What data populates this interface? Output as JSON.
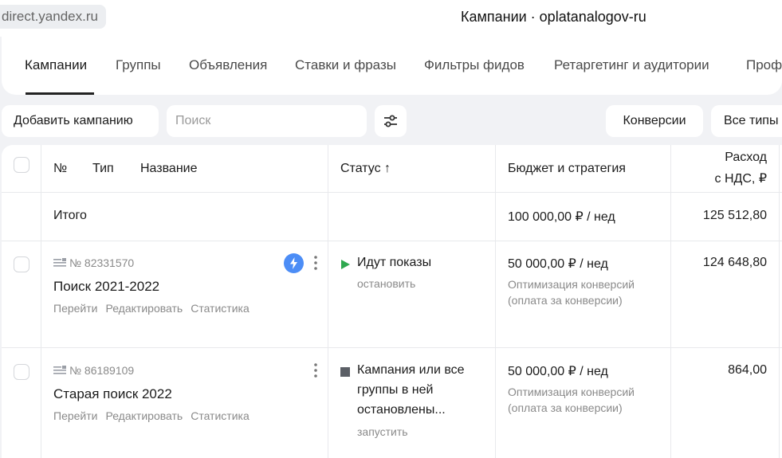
{
  "browser": {
    "url": "direct.yandex.ru",
    "title": "Кампании · oplatanalogov-ru"
  },
  "tabs": [
    {
      "label": "Кампании",
      "active": true
    },
    {
      "label": "Группы"
    },
    {
      "label": "Объявления"
    },
    {
      "label": "Ставки и фразы"
    },
    {
      "label": "Фильтры фидов"
    },
    {
      "label": "Ретаргетинг и аудитории"
    },
    {
      "label": "Проф"
    }
  ],
  "toolbar": {
    "add_campaign": "Добавить кампанию",
    "search_placeholder": "Поиск",
    "conversions": "Конверсии",
    "all_types": "Все типы"
  },
  "table": {
    "headers": {
      "number": "№",
      "type": "Тип",
      "name": "Название",
      "status": "Статус ↑",
      "budget": "Бюджет и стратегия",
      "spend_line1": "Расход",
      "spend_line2": "с НДС, ₽"
    },
    "total": {
      "label": "Итого",
      "budget": "100 000,00 ₽ / нед",
      "spend": "125 512,80"
    },
    "rows": [
      {
        "id": "№ 82331570",
        "name": "Поиск 2021-2022",
        "links": [
          "Перейти",
          "Редактировать",
          "Статистика"
        ],
        "status": "Идут показы",
        "status_action": "остановить",
        "budget": "50 000,00 ₽ / нед",
        "strategy_line1": "Оптимизация конверсий",
        "strategy_line2": "(оплата за конверсии)",
        "spend": "124 648,80"
      },
      {
        "id": "№ 86189109",
        "name": "Старая поиск 2022",
        "links": [
          "Перейти",
          "Редактировать",
          "Статистика"
        ],
        "status_line1": "Кампания или все",
        "status_line2": "группы в ней",
        "status_line3": "остановлены...",
        "status_action": "запустить",
        "budget": "50 000,00 ₽ / нед",
        "strategy_line1": "Оптимизация конверсий",
        "strategy_line2": "(оплата за конверсии)",
        "spend": "864,00"
      }
    ]
  },
  "colors": {
    "accent_blue": "#4c8df6",
    "status_green": "#2fa84f",
    "status_gray": "#5b5f66"
  }
}
